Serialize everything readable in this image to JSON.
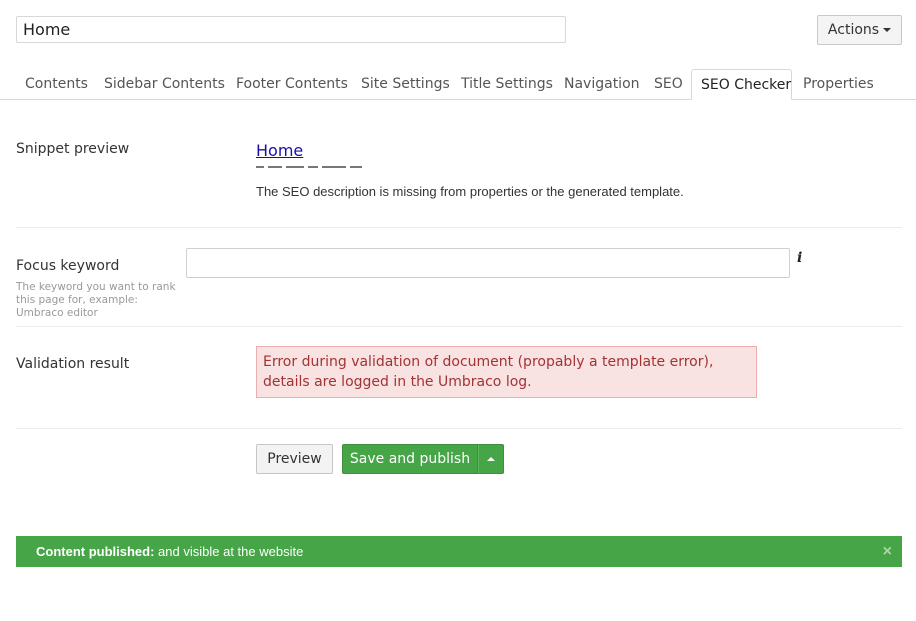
{
  "header": {
    "name_value": "Home",
    "actions_label": "Actions"
  },
  "tabs": [
    {
      "label": "Contents"
    },
    {
      "label": "Sidebar Contents"
    },
    {
      "label": "Footer Contents"
    },
    {
      "label": "Site Settings"
    },
    {
      "label": "Title Settings"
    },
    {
      "label": "Navigation"
    },
    {
      "label": "SEO"
    },
    {
      "label": "SEO Checker",
      "active": true
    },
    {
      "label": "Properties"
    }
  ],
  "snippet": {
    "label": "Snippet preview",
    "title": "Home",
    "description": "The SEO description is missing from properties or the generated template."
  },
  "focus": {
    "label": "Focus keyword",
    "hint": "The keyword you want to rank this page for, example: Umbraco editor",
    "value": "",
    "info_icon": "i"
  },
  "validation": {
    "label": "Validation result",
    "message": "Error during validation of document (propably a template error), details are logged in the Umbraco log."
  },
  "buttons": {
    "preview": "Preview",
    "save_publish": "Save and publish"
  },
  "notification": {
    "strong": "Content published:",
    "text": " and visible at the website",
    "close": "×"
  },
  "colors": {
    "success": "#46a546",
    "error_bg": "#f9e2e2",
    "error_text": "#a33333",
    "link": "#1a0dab"
  }
}
